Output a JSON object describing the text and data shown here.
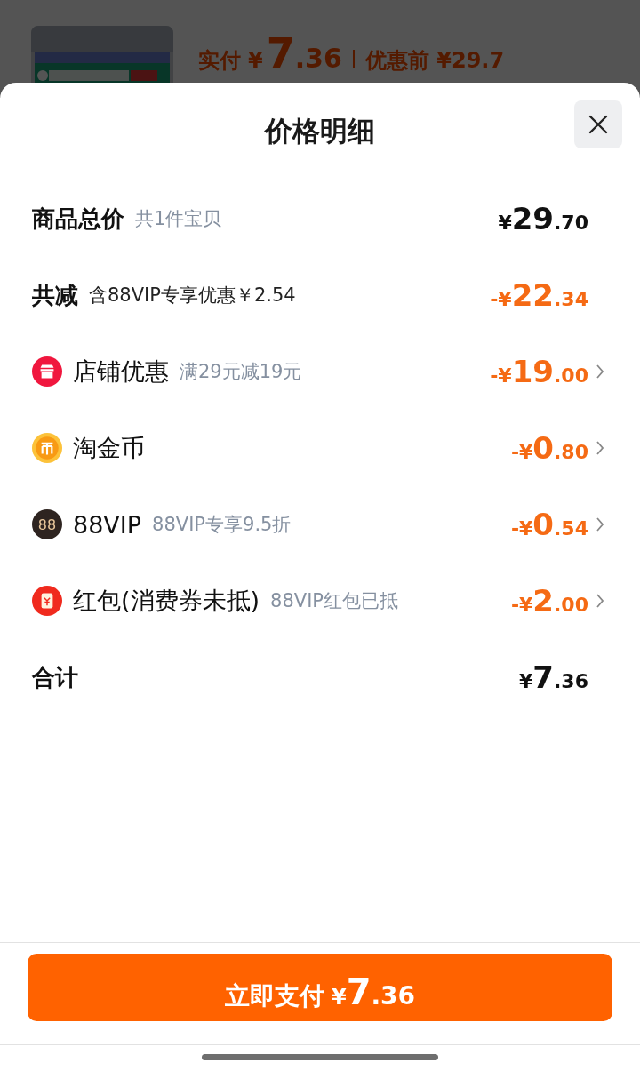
{
  "background": {
    "paid_label": "实付",
    "paid_price": {
      "prefix": "¥",
      "main": "7",
      "fraction": ".36"
    },
    "original_label": "优惠前",
    "original_price": "¥29.7"
  },
  "sheet": {
    "title": "价格明细",
    "rows": [
      {
        "kind": "summary",
        "label": "商品总价",
        "note": "共1件宝贝",
        "amount": {
          "prefix": "¥",
          "main": "29",
          "fraction": ".70"
        },
        "highlight": false
      },
      {
        "kind": "summary",
        "label": "共减",
        "note": "含88VIP专享优惠￥2.54",
        "amount": {
          "prefix": "-¥",
          "main": "22",
          "fraction": ".34"
        },
        "highlight": true
      },
      {
        "kind": "shop",
        "label": "店铺优惠",
        "note": "满29元减19元",
        "amount": {
          "prefix": "-¥",
          "main": "19",
          "fraction": ".00"
        },
        "highlight": true
      },
      {
        "kind": "coin",
        "label": "淘金币",
        "amount": {
          "prefix": "-¥",
          "main": "0",
          "fraction": ".80"
        },
        "highlight": true
      },
      {
        "kind": "vip",
        "icon_text": "88",
        "label": "88VIP",
        "note": "88VIP专享9.5折",
        "amount": {
          "prefix": "-¥",
          "main": "0",
          "fraction": ".54"
        },
        "highlight": true
      },
      {
        "kind": "packet",
        "label": "红包(消费券未抵)",
        "note": "88VIP红包已抵",
        "amount": {
          "prefix": "-¥",
          "main": "2",
          "fraction": ".00"
        },
        "highlight": true
      },
      {
        "kind": "summary",
        "label": "合计",
        "amount": {
          "prefix": "¥",
          "main": "7",
          "fraction": ".36"
        },
        "highlight": false
      }
    ],
    "pay_button": {
      "label": "立即支付",
      "price": {
        "prefix": "¥",
        "main": "7",
        "fraction": ".36"
      }
    }
  }
}
